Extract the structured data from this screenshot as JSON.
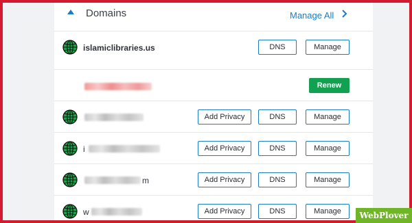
{
  "header": {
    "title": "Domains",
    "manage_all_label": "Manage All"
  },
  "colors": {
    "accent": "#1b7cc4",
    "renew_green": "#12a150",
    "globe_green": "#1aa548",
    "frame_red": "#d21b2e"
  },
  "rows": [
    {
      "name": "islamiclibraries.us",
      "dns_label": "DNS",
      "manage_label": "Manage"
    },
    {
      "renew_label": "Renew"
    },
    {
      "add_privacy_label": "Add Privacy",
      "dns_label": "DNS",
      "manage_label": "Manage"
    },
    {
      "prefix": "i",
      "add_privacy_label": "Add Privacy",
      "dns_label": "DNS",
      "manage_label": "Manage"
    },
    {
      "suffix": "m",
      "add_privacy_label": "Add Privacy",
      "dns_label": "DNS",
      "manage_label": "Manage"
    },
    {
      "prefix": "w",
      "add_privacy_label": "Add Privacy",
      "dns_label": "DNS",
      "manage_label": "Manage"
    }
  ],
  "watermark": {
    "text": "WebPlover"
  }
}
